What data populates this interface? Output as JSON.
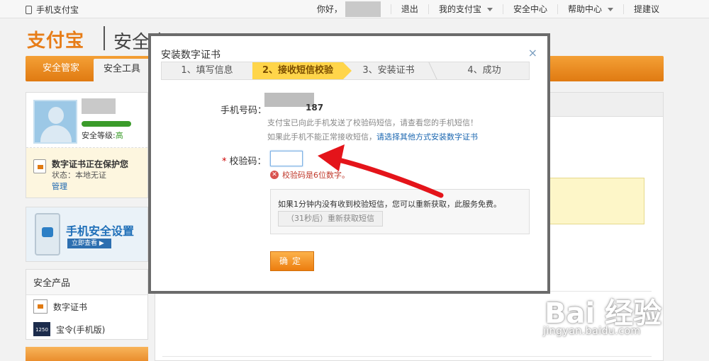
{
  "topbar": {
    "mobile_label": "手机支付宝",
    "greeting": "你好，",
    "links": [
      "退出",
      "我的支付宝",
      "安全中心",
      "帮助中心",
      "提建议"
    ]
  },
  "header": {
    "logo": "支付宝",
    "section_title": "安全中心"
  },
  "nav": {
    "tabs": [
      "安全管家",
      "安全工具"
    ]
  },
  "profile": {
    "security_level_label": "安全等级:",
    "security_level_value": "高",
    "cert_title": "数字证书正在保护您",
    "cert_status": "状态：本地无证",
    "cert_manage": "管理"
  },
  "promo": {
    "title": "手机安全设置",
    "button": "立即查看 ▶"
  },
  "products": {
    "heading": "安全产品",
    "items": [
      "数字证书",
      "宝令(手机版)"
    ],
    "token_label": "1250"
  },
  "modal": {
    "title": "安装数字证书",
    "close": "×",
    "steps": [
      "1、填写信息",
      "2、接收短信校验",
      "3、安装证书",
      "4、成功"
    ],
    "active_step": 2,
    "phone_label": "手机号码：",
    "phone_value_suffix": "187",
    "hint_sent": "支付宝已向此手机发送了校验码短信，请查看您的手机短信！",
    "hint_cannot_receive": "如果此手机不能正常接收短信，",
    "hint_link": "请选择其他方式安装数字证书",
    "code_required_mark": "*",
    "code_label": "校验码：",
    "code_value": "",
    "error_text": "校验码是6位数字。",
    "resend_info": "如果1分钟内没有收到校验短信，您可以重新获取，此服务免费。",
    "resend_button": "（31秒后）重新获取短信",
    "confirm_button": "确定"
  },
  "watermark": {
    "logo": "Bai 经验",
    "url": "jingyan.baidu.com"
  },
  "colors": {
    "orange": "#e07a12",
    "highlight_step": "#ffd54a",
    "error": "#c0392b",
    "link": "#1a66b0"
  }
}
